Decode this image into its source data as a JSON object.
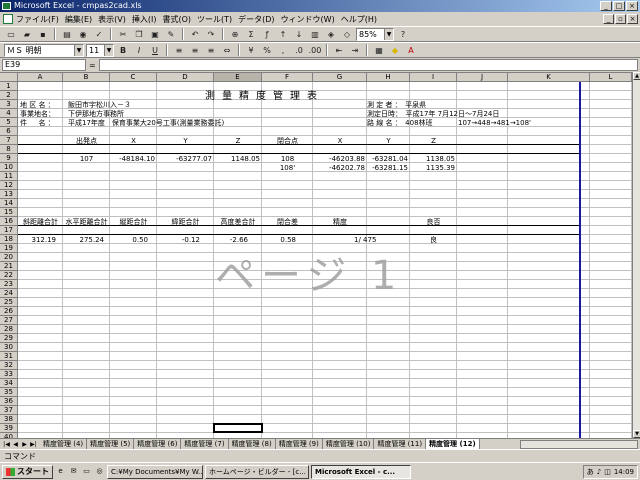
{
  "window": {
    "title": "Microsoft Excel - cmpas2cad.xls"
  },
  "menu": [
    "ファイル(F)",
    "編集(E)",
    "表示(V)",
    "挿入(I)",
    "書式(O)",
    "ツール(T)",
    "データ(D)",
    "ウィンドウ(W)",
    "ヘルプ(H)"
  ],
  "toolbar": {
    "font_name": "ＭＳ 明朝",
    "font_size": "11",
    "zoom": "85%"
  },
  "formula_bar": {
    "name_box": "E39",
    "equals": "=",
    "content": ""
  },
  "columns": [
    "A",
    "B",
    "C",
    "D",
    "E",
    "F",
    "G",
    "H",
    "I",
    "J",
    "K",
    "L"
  ],
  "rows": [
    "1",
    "2",
    "3",
    "4",
    "5",
    "6",
    "7",
    "8",
    "9",
    "10",
    "11",
    "12",
    "13",
    "14",
    "15",
    "16",
    "17",
    "18",
    "19",
    "20",
    "21",
    "22",
    "23",
    "24",
    "25",
    "26",
    "27",
    "28",
    "29",
    "30",
    "31",
    "32",
    "33",
    "34",
    "35",
    "36",
    "37",
    "38",
    "39",
    "40"
  ],
  "sheet": {
    "title": "測量精度管理表",
    "r3a": "地 区 名 ：",
    "r3b": "飯田市宇松川入－３",
    "r4a": "事業地名：",
    "r4b": "下伊那地方事務所",
    "r5a": "件 　 名 ：",
    "r5b": "平成17年度　保育事業大20号工事(測量業務委託)",
    "r3h": "測 定 者 ：　平泉県",
    "r4h": "測定日時：　平成17年 7月12日～7月24日",
    "r5h": "路 線 名 ：　408林班",
    "r5j": "107→448→481→108'",
    "h_start": "出発点",
    "h_x": "X",
    "h_y": "Y",
    "h_z": "Z",
    "h_close": "閉合点",
    "h_x2": "X",
    "h_y2": "Y",
    "h_z2": "Z",
    "r9b": "107",
    "r9c": "-48184.10",
    "r9d": "-63277.07",
    "r9e": "1148.05",
    "r9f": "108",
    "r9g": "-46203.88",
    "r9h": "-63281.04",
    "r9i": "1138.05",
    "r10f": "108'",
    "r10g": "-46202.78",
    "r10h": "-63281.15",
    "r10i": "1135.39",
    "h16a": "斜距離合計",
    "h16b": "水平距離合計",
    "h16c": "縦距合計",
    "h16d": "緯距合計",
    "h16e": "高度差合計",
    "h16f": "閉合差",
    "h16g": "精度",
    "h16i": "良否",
    "r18a": "312.19",
    "r18b": "275.24",
    "r18c": "0.50",
    "r18d": "-0.12",
    "r18e": "-2.66",
    "r18f": "0.58",
    "r18g": "1/ 475",
    "r18i": "良"
  },
  "watermark": "ページ 1",
  "tabs": [
    "精度管理 (4)",
    "精度管理 (5)",
    "精度管理 (6)",
    "精度管理 (7)",
    "精度管理 (8)",
    "精度管理 (9)",
    "精度管理 (10)",
    "精度管理 (11)",
    "精度管理 (12)"
  ],
  "status": "コマンド",
  "taskbar": {
    "start": "スタート",
    "tasks": [
      "C:¥My Documents¥My W...",
      "ホームページ・ビルダー - [c...",
      "Microsoft Excel - c..."
    ],
    "clock": "14:09"
  }
}
